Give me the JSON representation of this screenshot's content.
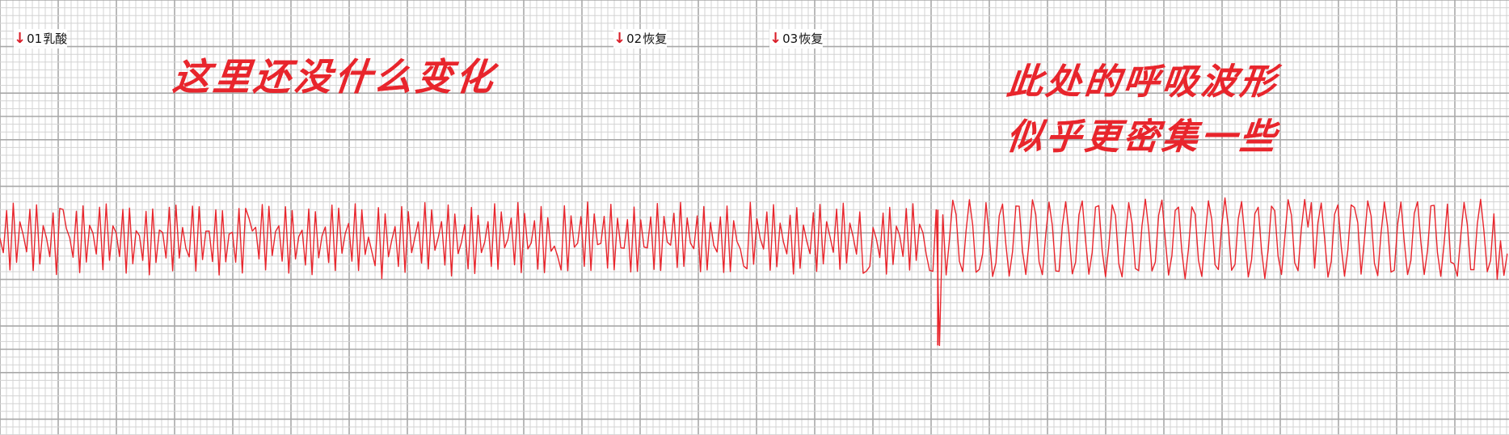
{
  "recording": {
    "markers": [
      {
        "code": "01",
        "label": "乳酸"
      },
      {
        "code": "02",
        "label": "恢复"
      },
      {
        "code": "03",
        "label": "恢复"
      }
    ],
    "annotations": [
      "这里还没什么变化",
      "此处的呼吸波形",
      "似乎更密集一些"
    ]
  },
  "chart_data": {
    "type": "line",
    "title": "",
    "xlabel": "",
    "ylabel": "",
    "grid": true,
    "series": [
      {
        "color": "#e8252c",
        "segments": [
          {
            "x_range": [
              0,
              0.62
            ],
            "amplitude_range": [
              -0.82,
              0.82
            ],
            "density": "regular"
          },
          {
            "x_range": [
              0.62,
              0.625
            ],
            "amplitude_range": [
              -2.45,
              0.66
            ],
            "density": "single-spike"
          },
          {
            "x_range": [
              0.625,
              1.0
            ],
            "amplitude_range": [
              -0.9,
              0.92
            ],
            "density": "denser"
          }
        ]
      }
    ],
    "xlim": [
      0,
      1
    ],
    "ylim": [
      -2.6,
      1.2
    ]
  }
}
